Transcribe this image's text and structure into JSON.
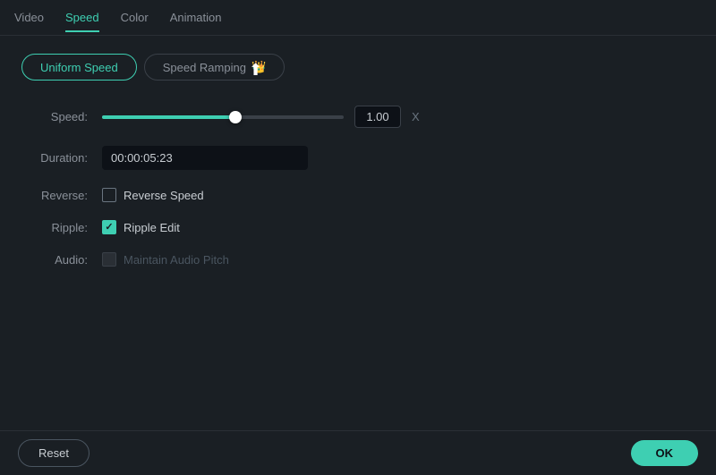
{
  "top_tabs": {
    "items": [
      {
        "id": "video",
        "label": "Video",
        "active": false
      },
      {
        "id": "speed",
        "label": "Speed",
        "active": true
      },
      {
        "id": "color",
        "label": "Color",
        "active": false
      },
      {
        "id": "animation",
        "label": "Animation",
        "active": false
      }
    ]
  },
  "mode_buttons": {
    "uniform_speed": {
      "label": "Uniform Speed",
      "active": true
    },
    "speed_ramping": {
      "label": "Speed Ramping",
      "active": false,
      "crown_icon": "👑"
    }
  },
  "form": {
    "speed": {
      "label": "Speed:",
      "slider_percent": 55,
      "value": "1.00",
      "unit": "X"
    },
    "duration": {
      "label": "Duration:",
      "value": "00:00:05:23"
    },
    "reverse": {
      "label": "Reverse:",
      "checkbox_label": "Reverse Speed",
      "checked": false
    },
    "ripple": {
      "label": "Ripple:",
      "checkbox_label": "Ripple Edit",
      "checked": true
    },
    "audio": {
      "label": "Audio:",
      "checkbox_label": "Maintain Audio Pitch",
      "checked": false,
      "disabled": true
    }
  },
  "bottom_bar": {
    "reset_label": "Reset",
    "ok_label": "OK"
  }
}
